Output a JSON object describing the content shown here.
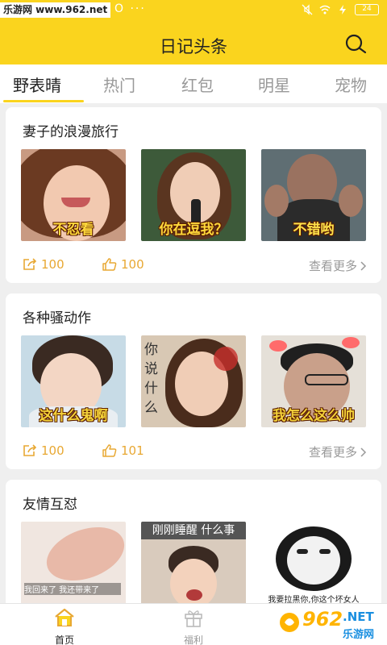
{
  "status_bar": {
    "watermark": "乐游网 www.962.net",
    "battery": "24"
  },
  "header": {
    "title": "日记头条"
  },
  "tabs": [
    {
      "label": "野表晴",
      "active": true
    },
    {
      "label": "热门",
      "active": false
    },
    {
      "label": "红包",
      "active": false
    },
    {
      "label": "明星",
      "active": false
    },
    {
      "label": "宠物",
      "active": false
    }
  ],
  "cards": [
    {
      "title": "妻子的浪漫旅行",
      "captions": [
        "不忍看",
        "你在逗我？",
        "不错哟"
      ],
      "shares": "100",
      "likes": "100",
      "more": "查看更多"
    },
    {
      "title": "各种骚动作",
      "captions": [
        "这什么鬼啊",
        "你说什么",
        "我怎么这么帅"
      ],
      "shares": "100",
      "likes": "101",
      "more": "查看更多"
    },
    {
      "title": "友情互怼",
      "captions": [
        "我回来了 我还带来了",
        "刚刚睡醒 什么事",
        "我要拉黑你,你这个坏女人"
      ]
    }
  ],
  "bottom_nav": [
    {
      "label": "首页",
      "icon": "home-icon",
      "active": true
    },
    {
      "label": "福利",
      "icon": "gift-icon",
      "active": false
    }
  ],
  "badge": {
    "logo": "962",
    "suffix": ".NET",
    "site": "乐游网"
  },
  "colors": {
    "brand_yellow": "#fad41e",
    "stat_orange": "#e8a833",
    "muted": "#999999"
  }
}
